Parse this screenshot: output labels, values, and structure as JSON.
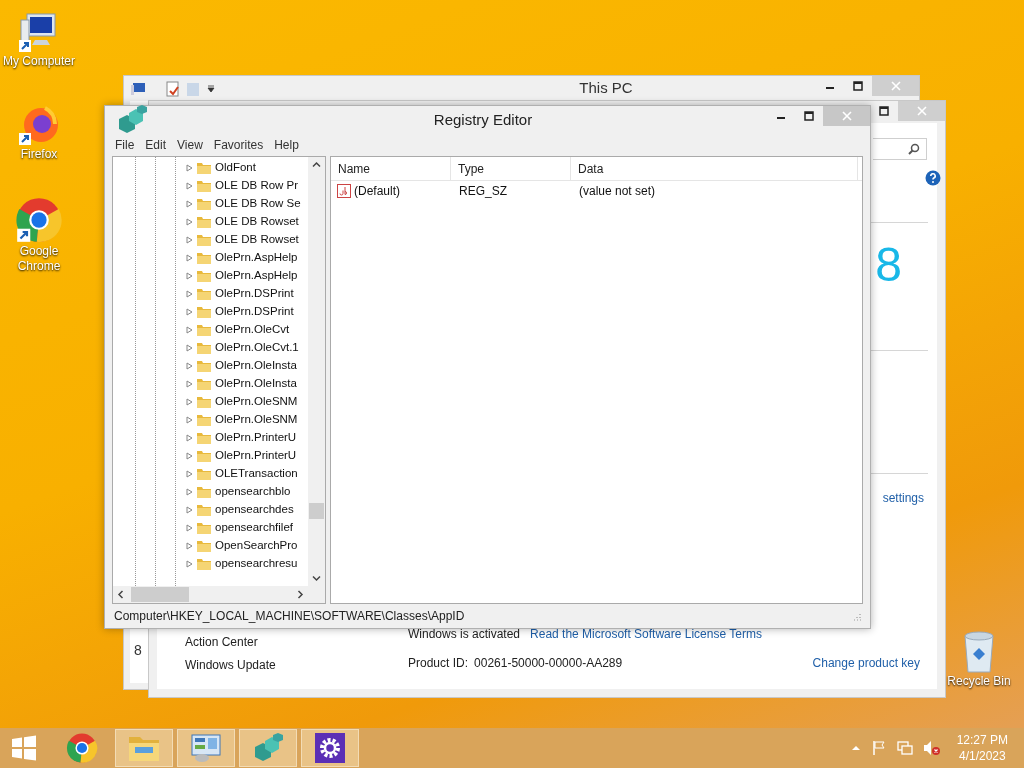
{
  "desktop_icons": [
    {
      "kind": "computer",
      "label": "My Computer"
    },
    {
      "kind": "firefox",
      "label": "Firefox"
    },
    {
      "kind": "chrome",
      "label": "Google Chrome"
    }
  ],
  "recycle_bin": {
    "label": "Recycle Bin"
  },
  "this_pc_window": {
    "title": "This PC",
    "content_fragment": "8"
  },
  "system_window": {
    "big_digit": "8",
    "settings_link": "settings",
    "nav_items": [
      "Action Center",
      "Windows Update"
    ],
    "activation_status": "Windows is activated",
    "license_link": "Read the Microsoft Software License Terms",
    "product_id_label": "Product ID:",
    "product_id": "00261-50000-00000-AA289",
    "change_key_link": "Change product key"
  },
  "registry_editor": {
    "title": "Registry Editor",
    "menu": [
      "File",
      "Edit",
      "View",
      "Favorites",
      "Help"
    ],
    "tree_items": [
      {
        "label": "OldFont",
        "expanded": false
      },
      {
        "label": "OLE DB Row Pr",
        "expanded": false
      },
      {
        "label": "OLE DB Row Se",
        "expanded": false
      },
      {
        "label": "OLE DB Rowset",
        "expanded": false
      },
      {
        "label": "OLE DB Rowset",
        "expanded": false
      },
      {
        "label": "OlePrn.AspHelp",
        "expanded": false
      },
      {
        "label": "OlePrn.AspHelp",
        "expanded": false
      },
      {
        "label": "OlePrn.DSPrint",
        "expanded": false
      },
      {
        "label": "OlePrn.DSPrint",
        "expanded": false
      },
      {
        "label": "OlePrn.OleCvt",
        "expanded": false
      },
      {
        "label": "OlePrn.OleCvt.1",
        "expanded": false
      },
      {
        "label": "OlePrn.OleInsta",
        "expanded": false
      },
      {
        "label": "OlePrn.OleInsta",
        "expanded": false
      },
      {
        "label": "OlePrn.OleSNM",
        "expanded": false
      },
      {
        "label": "OlePrn.OleSNM",
        "expanded": false
      },
      {
        "label": "OlePrn.PrinterU",
        "expanded": false
      },
      {
        "label": "OlePrn.PrinterU",
        "expanded": false
      },
      {
        "label": "OLETransaction",
        "expanded": false
      },
      {
        "label": "opensearchblo",
        "expanded": false
      },
      {
        "label": "opensearchdes",
        "expanded": false
      },
      {
        "label": "opensearchfilef",
        "expanded": false
      },
      {
        "label": "OpenSearchPro",
        "expanded": false
      },
      {
        "label": "opensearchresu",
        "expanded": false
      }
    ],
    "columns": [
      "Name",
      "Type",
      "Data"
    ],
    "rows": [
      {
        "name": "(Default)",
        "type": "REG_SZ",
        "data": "(value not set)"
      }
    ],
    "status_path": "Computer\\HKEY_LOCAL_MACHINE\\SOFTWARE\\Classes\\AppID"
  },
  "taskbar": {
    "items": [
      {
        "kind": "chrome",
        "running": false
      },
      {
        "kind": "explorer",
        "running": true
      },
      {
        "kind": "control-panel",
        "running": true
      },
      {
        "kind": "regedit",
        "running": true
      },
      {
        "kind": "settings",
        "running": true
      }
    ],
    "volume_muted": true,
    "time": "12:27 PM",
    "date": "4/1/2023"
  }
}
